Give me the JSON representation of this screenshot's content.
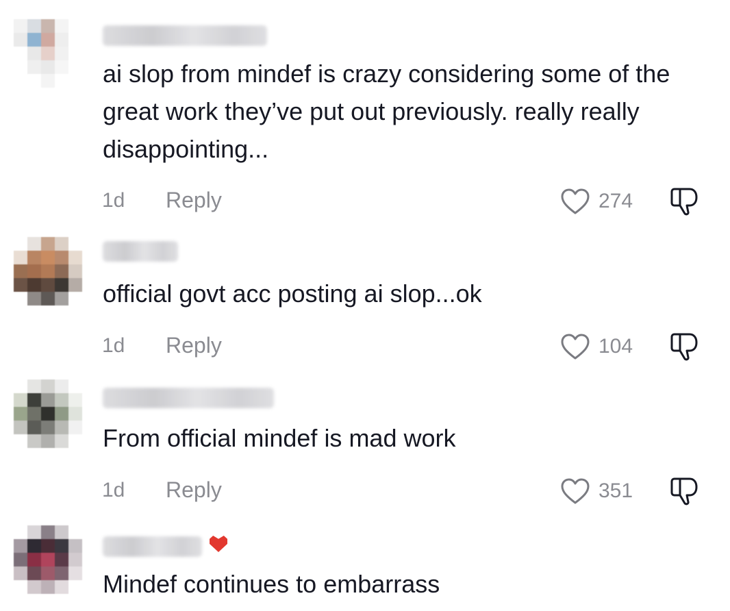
{
  "comments": [
    {
      "text": "ai slop from mindef is crazy considering some of the great work they’ve put out previously. really really disappointing...",
      "time": "1d",
      "reply_label": "Reply",
      "likes": "274",
      "avatar_icon": "blurred-avatar",
      "avatar_colors": [
        "#f2f2f2",
        "#d9dde2",
        "#c9b6ae",
        "#f4f4f4",
        "#ffffff",
        "#eaeaea",
        "#8fb3d1",
        "#d0a9a0",
        "#eeeeee",
        "#ffffff",
        "#ffffff",
        "#e8e8e8",
        "#e6d0ca",
        "#f1f1f1",
        "#ffffff",
        "#ffffff",
        "#efefef",
        "#e9e9e9",
        "#f6f6f6",
        "#ffffff",
        "#ffffff",
        "#ffffff",
        "#f4f4f4",
        "#ffffff",
        "#ffffff"
      ]
    },
    {
      "text": "official govt acc posting ai slop...ok",
      "time": "1d",
      "reply_label": "Reply",
      "likes": "104",
      "avatar_icon": "blurred-avatar",
      "avatar_colors": [
        "#ffffff",
        "#e7e2de",
        "#c7a58e",
        "#dcd0c6",
        "#ffffff",
        "#e9ddd3",
        "#b98563",
        "#c98c62",
        "#b88a6e",
        "#e7dbd0",
        "#9a6f52",
        "#a46e4e",
        "#b27a56",
        "#8c6a56",
        "#d6cbc2",
        "#6b5346",
        "#4d3a31",
        "#5f4a3f",
        "#3c3733",
        "#b5aca6",
        "#ffffff",
        "#8f8a87",
        "#5e5956",
        "#a3a09e",
        "#ffffff"
      ]
    },
    {
      "text": "From official mindef is mad work",
      "time": "1d",
      "reply_label": "Reply",
      "likes": "351",
      "avatar_icon": "blurred-avatar",
      "avatar_colors": [
        "#ffffff",
        "#e5e5e3",
        "#d3d3d0",
        "#ececec",
        "#ffffff",
        "#d4d8cc",
        "#3d3f3a",
        "#9a9b96",
        "#c3c8bf",
        "#eef0ec",
        "#9aa58c",
        "#6f7168",
        "#2f302c",
        "#8f9a86",
        "#dfe3dc",
        "#c3c4bf",
        "#5b5c57",
        "#7c7d78",
        "#b8b9b4",
        "#f1f1f1",
        "#ffffff",
        "#c9c9c6",
        "#b0b0ad",
        "#dadad8",
        "#ffffff"
      ]
    },
    {
      "text": "Mindef continues to embarrass",
      "avatar_icon": "blurred-avatar",
      "avatar_colors": [
        "#ffffff",
        "#d9d5d8",
        "#8a8088",
        "#cdc9cc",
        "#ffffff",
        "#a49aa2",
        "#2e2a33",
        "#4a2d37",
        "#3b3840",
        "#c5c0c4",
        "#7b6e78",
        "#8a2f45",
        "#b0445c",
        "#5a3a48",
        "#d2cbcf",
        "#c9bfc4",
        "#6c4a55",
        "#9d5a6a",
        "#7e6470",
        "#e5dfe2",
        "#ffffff",
        "#d2c9cd",
        "#bdb1b7",
        "#e2dbde",
        "#ffffff"
      ]
    }
  ],
  "colors": {
    "text": "#161823",
    "meta": "#8a8b91",
    "flag": "#e2382f"
  }
}
